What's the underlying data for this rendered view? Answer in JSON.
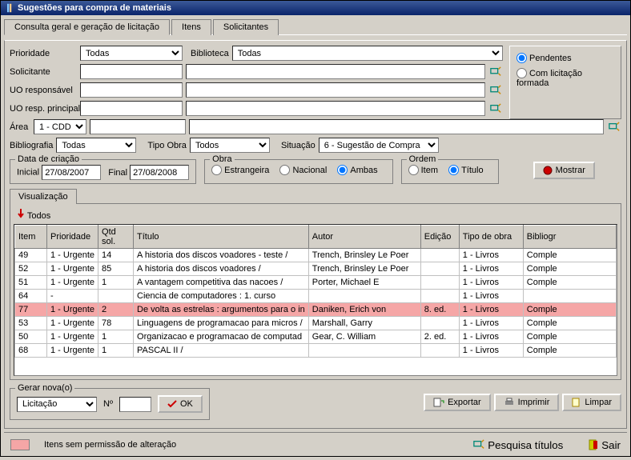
{
  "title": "Sugestões para compra de materiais",
  "tabs": {
    "t1": "Consulta geral e geração de licitação",
    "t2": "Itens",
    "t3": "Solicitantes"
  },
  "form": {
    "prioridade_label": "Prioridade",
    "prioridade_value": "Todas",
    "biblioteca_label": "Biblioteca",
    "biblioteca_value": "Todas",
    "solicitante_label": "Solicitante",
    "uo_resp_label": "UO responsável",
    "uo_resp_princ_label": "UO resp. principal",
    "area_label": "Área",
    "area_value": "1 - CDD",
    "bibliografia_label": "Bibliografia",
    "bibliografia_value": "Todas",
    "tipo_obra_label": "Tipo Obra",
    "tipo_obra_value": "Todos",
    "situacao_label": "Situação",
    "situacao_value": "6 - Sugestão de Compra"
  },
  "filter_status": {
    "pendentes": "Pendentes",
    "com_licitacao": "Com licitação formada"
  },
  "data_criacao": {
    "legend": "Data de criação",
    "inicial_label": "Inicial",
    "inicial": "27/08/2007",
    "final_label": "Final",
    "final": "27/08/2008"
  },
  "obra": {
    "legend": "Obra",
    "estrangeira": "Estrangeira",
    "nacional": "Nacional",
    "ambas": "Ambas"
  },
  "ordem": {
    "legend": "Ordem",
    "item": "Item",
    "titulo": "Título"
  },
  "mostrar": "Mostrar",
  "visualizacao": "Visualização",
  "todos": "Todos",
  "columns": {
    "item": "Item",
    "prioridade": "Prioridade",
    "qtd": "Qtd sol.",
    "titulo": "Título",
    "autor": "Autor",
    "edicao": "Edição",
    "tipo_obra": "Tipo de obra",
    "bibliog": "Bibliogr"
  },
  "rows": [
    {
      "item": "49",
      "pri": "1 - Urgente",
      "qtd": "14",
      "titulo": "A historia dos discos voadores - teste /",
      "autor": "Trench, Brinsley Le Poer",
      "ed": "",
      "tipo": "1 - Livros",
      "bib": "Comple",
      "hl": false
    },
    {
      "item": "52",
      "pri": "1 - Urgente",
      "qtd": "85",
      "titulo": "A historia dos discos voadores /",
      "autor": "Trench, Brinsley Le Poer",
      "ed": "",
      "tipo": "1 - Livros",
      "bib": "Comple",
      "hl": false
    },
    {
      "item": "51",
      "pri": "1 - Urgente",
      "qtd": "1",
      "titulo": "A vantagem competitiva das nacoes /",
      "autor": "Porter, Michael E",
      "ed": "",
      "tipo": "1 - Livros",
      "bib": "Comple",
      "hl": false
    },
    {
      "item": "64",
      "pri": "-",
      "qtd": "",
      "titulo": "Ciencia de computadores : 1. curso",
      "autor": "",
      "ed": "",
      "tipo": "1 - Livros",
      "bib": "",
      "hl": false
    },
    {
      "item": "77",
      "pri": "1 - Urgente",
      "qtd": "2",
      "titulo": "De volta as estrelas : argumentos para o in",
      "autor": "Daniken, Erich von",
      "ed": "8. ed.",
      "tipo": "1 - Livros",
      "bib": "Comple",
      "hl": true
    },
    {
      "item": "53",
      "pri": "1 - Urgente",
      "qtd": "78",
      "titulo": "Linguagens de programacao para micros /",
      "autor": "Marshall, Garry",
      "ed": "",
      "tipo": "1 - Livros",
      "bib": "Comple",
      "hl": false
    },
    {
      "item": "50",
      "pri": "1 - Urgente",
      "qtd": "1",
      "titulo": "Organizacao e programacao de computad",
      "autor": "Gear, C. William",
      "ed": "2. ed.",
      "tipo": "1 - Livros",
      "bib": "Comple",
      "hl": false
    },
    {
      "item": "68",
      "pri": "1 - Urgente",
      "qtd": "1",
      "titulo": "PASCAL II /",
      "autor": "",
      "ed": "",
      "tipo": "1 - Livros",
      "bib": "Comple",
      "hl": false
    }
  ],
  "gerar": {
    "legend": "Gerar nova(o)",
    "licitacao": "Licitação",
    "n_label": "Nº",
    "ok": "OK"
  },
  "actions": {
    "exportar": "Exportar",
    "imprimir": "Imprimir",
    "limpar": "Limpar"
  },
  "legend_text": "Itens sem permissão de alteração",
  "footer": {
    "pesquisa": "Pesquisa títulos",
    "sair": "Sair"
  }
}
